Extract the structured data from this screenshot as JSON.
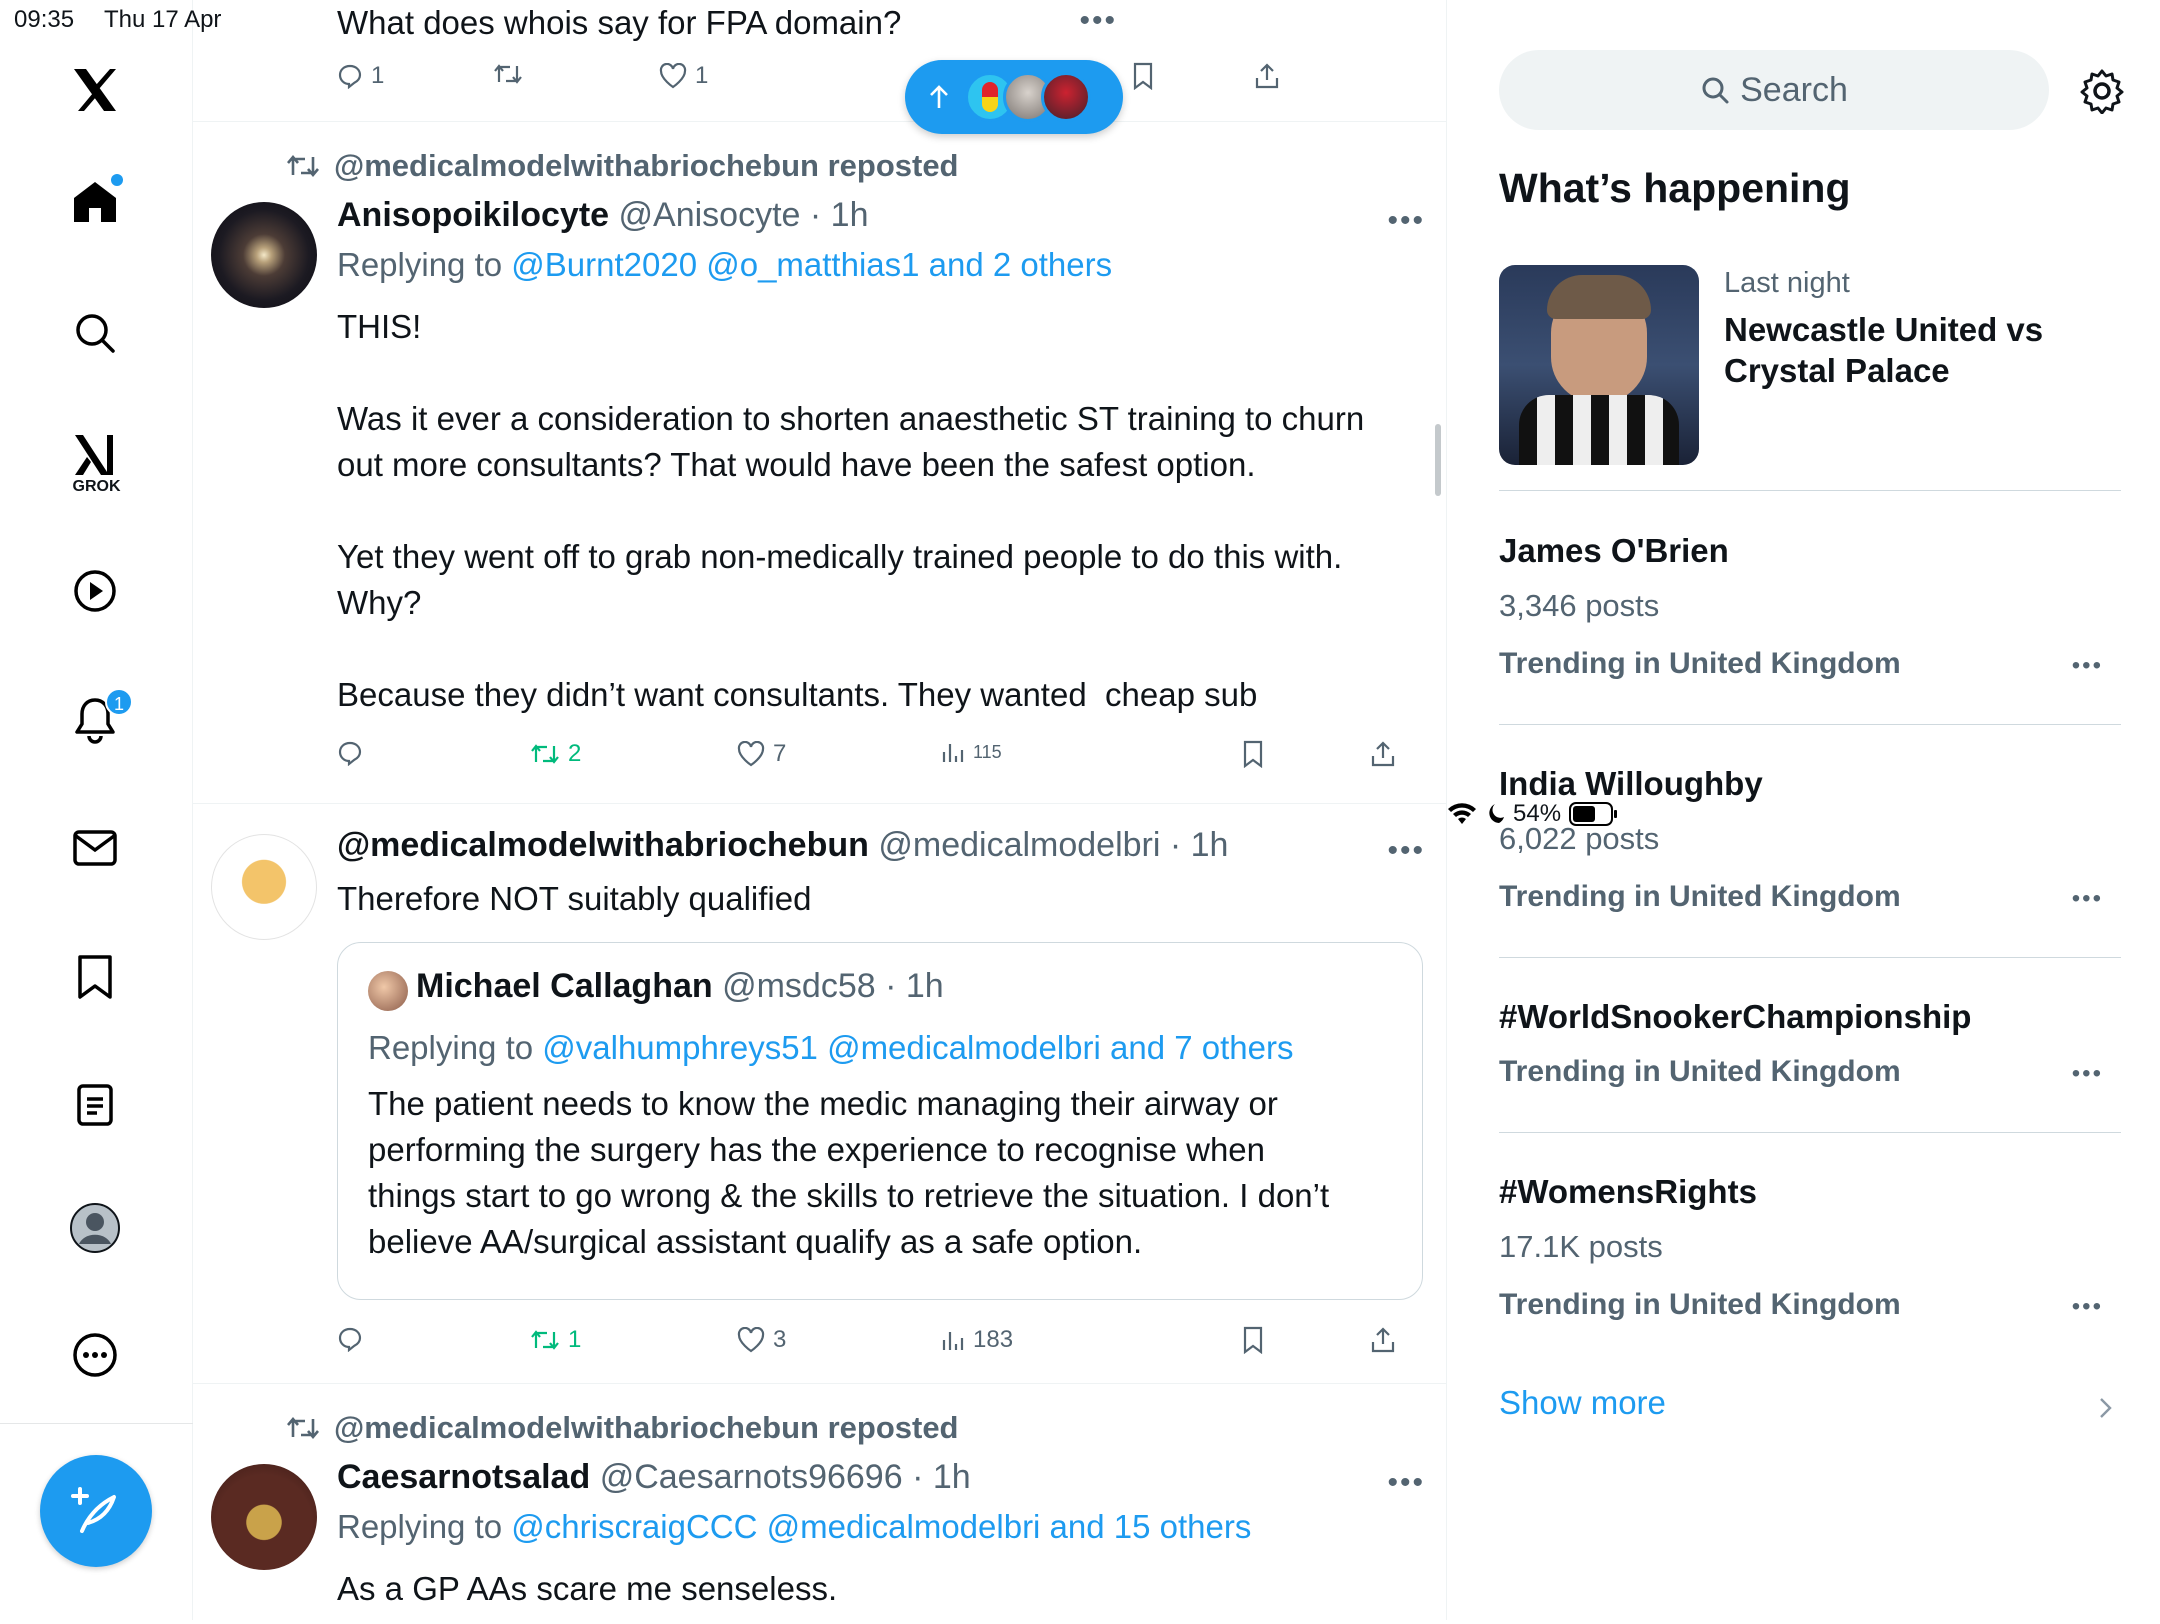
{
  "status": {
    "time": "09:35",
    "date": "Thu 17 Apr",
    "battery": "54%"
  },
  "nav": {
    "grok_label": "GROK",
    "notif_count": "1"
  },
  "top_post": {
    "text": "What does whois say for FPA domain?",
    "replies": "1",
    "likes": "1"
  },
  "post1": {
    "reposted_by": "@medicalmodelwithabriochebun reposted",
    "name": "Anisopoikilocyte",
    "handle": "@Anisocyte",
    "time": "· 1h",
    "replying_prefix": "Replying to ",
    "replying_links": "@Burnt2020 @o_matthias1 and 2 others",
    "text": "THIS!\n\nWas it ever a consideration to shorten anaesthetic ST training to churn\nout more consultants? That would have been the safest option.\n\nYet they went off to grab non-medically trained people to do this with.\nWhy?\n\nBecause they didn’t want consultants. They wanted  cheap sub",
    "reposts": "2",
    "likes": "7",
    "views": "115"
  },
  "post2": {
    "name": "@medicalmodelwithabriochebun",
    "handle": "@medicalmodelbri",
    "time": "· 1h",
    "text": "Therefore NOT suitably qualified",
    "quote": {
      "name": "Michael Callaghan",
      "handle": "@msdc58",
      "time": "· 1h",
      "replying_prefix": "Replying to ",
      "replying_links": "@valhumphreys51 @medicalmodelbri and 7 others",
      "text": "The patient needs to know the medic managing their airway or\nperforming the surgery has the experience to recognise when\nthings start to go wrong & the skills to retrieve the situation. I don’t\nbelieve AA/surgical assistant qualify as a safe option."
    },
    "reposts": "1",
    "likes": "3",
    "views": "183"
  },
  "post3": {
    "reposted_by": "@medicalmodelwithabriochebun reposted",
    "name": "Caesarnotsalad",
    "handle": "@Caesarnots96696",
    "time": "· 1h",
    "replying_prefix": "Replying to ",
    "replying_links": "@chriscraigCCC @medicalmodelbri and 15 others",
    "text": "As a GP AAs scare me senseless."
  },
  "sidebar_right": {
    "search_placeholder": "Search",
    "heading": "What’s happening",
    "featured": {
      "time": "Last night",
      "title": "Newcastle United vs Crystal Palace"
    },
    "trends": [
      {
        "name": "James O'Brien",
        "posts": "3,346 posts",
        "context": "Trending in United Kingdom"
      },
      {
        "name": "India Willoughby",
        "posts": "6,022 posts",
        "context": "Trending in United Kingdom"
      },
      {
        "name": "#WorldSnookerChampionship",
        "posts": "",
        "context": "Trending in United Kingdom"
      },
      {
        "name": "#WomensRights",
        "posts": "17.1K posts",
        "context": "Trending in United Kingdom"
      }
    ],
    "show_more": "Show more"
  },
  "colors": {
    "accent": "#1d9bf0",
    "repost_green": "#00ba7c",
    "secondary_text": "#536471"
  }
}
